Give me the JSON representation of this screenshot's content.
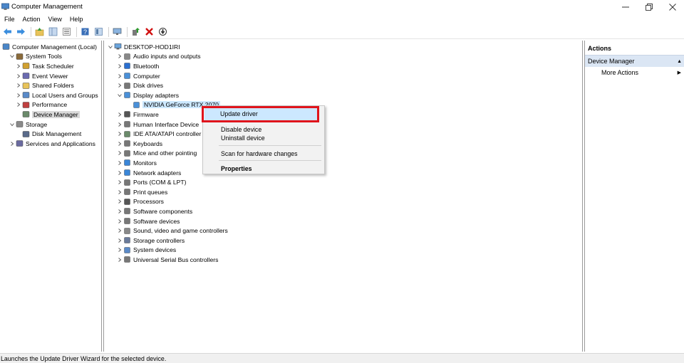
{
  "window": {
    "title": "Computer Management"
  },
  "menu": [
    "File",
    "Action",
    "View",
    "Help"
  ],
  "left_tree": [
    {
      "label": "Computer Management (Local)",
      "depth": 0,
      "chev": ""
    },
    {
      "label": "System Tools",
      "depth": 1,
      "chev": "down"
    },
    {
      "label": "Task Scheduler",
      "depth": 2,
      "chev": "right"
    },
    {
      "label": "Event Viewer",
      "depth": 2,
      "chev": "right"
    },
    {
      "label": "Shared Folders",
      "depth": 2,
      "chev": "right"
    },
    {
      "label": "Local Users and Groups",
      "depth": 2,
      "chev": "right"
    },
    {
      "label": "Performance",
      "depth": 2,
      "chev": "right"
    },
    {
      "label": "Device Manager",
      "depth": 2,
      "chev": "",
      "selected": true
    },
    {
      "label": "Storage",
      "depth": 1,
      "chev": "down"
    },
    {
      "label": "Disk Management",
      "depth": 2,
      "chev": ""
    },
    {
      "label": "Services and Applications",
      "depth": 1,
      "chev": "right"
    }
  ],
  "device_tree": {
    "root": "DESKTOP-HOD1IRI",
    "categories": [
      "Audio inputs and outputs",
      "Bluetooth",
      "Computer",
      "Disk drives",
      "Display adapters",
      "NVIDIA GeForce RTX 2070",
      "Firmware",
      "Human Interface Device",
      "IDE ATA/ATAPI controller",
      "Keyboards",
      "Mice and other pointing",
      "Monitors",
      "Network adapters",
      "Ports (COM & LPT)",
      "Print queues",
      "Processors",
      "Software components",
      "Software devices",
      "Sound, video and game controllers",
      "Storage controllers",
      "System devices",
      "Universal Serial Bus controllers"
    ]
  },
  "context_menu": {
    "update": "Update driver",
    "disable": "Disable device",
    "uninstall": "Uninstall device",
    "scan": "Scan for hardware changes",
    "properties": "Properties"
  },
  "actions": {
    "header": "Actions",
    "section": "Device Manager",
    "more": "More Actions"
  },
  "status": "Launches the Update Driver Wizard for the selected device.",
  "colors": {
    "highlight": "#e0141c",
    "selection": "#cce8ff",
    "section_bg": "#dbe6f4"
  }
}
